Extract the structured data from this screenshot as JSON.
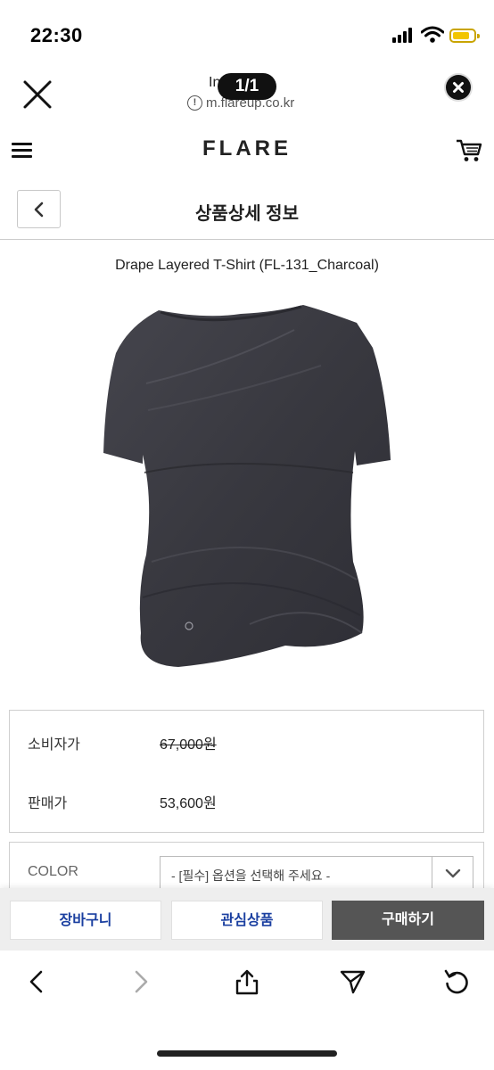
{
  "status_bar": {
    "time": "22:30",
    "icons": [
      "signal-icon",
      "wifi-icon",
      "battery-icon"
    ]
  },
  "viewer": {
    "site_title": "In          n",
    "site_url": "m.flareup.co.kr",
    "page_counter": "1/1"
  },
  "store": {
    "logo": "FLARE"
  },
  "subheader": {
    "title": "상품상세 정보"
  },
  "product": {
    "name": "Drape Layered T-Shirt (FL-131_Charcoal)",
    "image_color": "#3b3b42"
  },
  "prices": {
    "consumer_label": "소비자가",
    "consumer_price": "67,000원",
    "sale_label": "판매가",
    "sale_price": "53,600원"
  },
  "option": {
    "label": "COLOR",
    "placeholder": "- [필수] 옵션을 선택해 주세요 -"
  },
  "actions": {
    "cart": "장바구니",
    "wishlist": "관심상품",
    "buy": "구매하기"
  },
  "colors": {
    "accent_blue": "#1a3fa0",
    "buy_button": "#555555",
    "battery": "#f2c500"
  }
}
